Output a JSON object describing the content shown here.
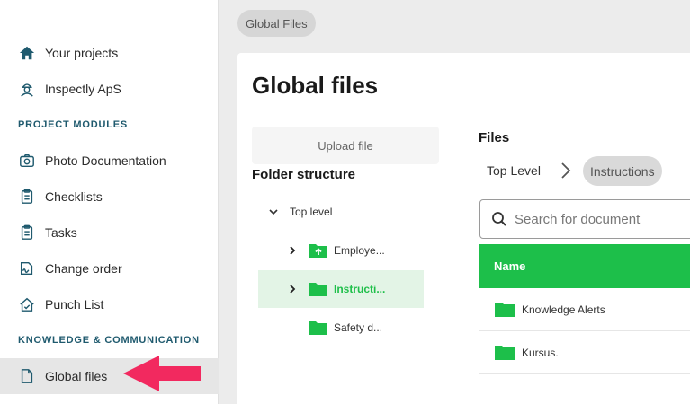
{
  "sidebar": {
    "items": [
      {
        "label": "Your projects",
        "icon": "home-icon"
      },
      {
        "label": "Inspectly ApS",
        "icon": "worker-icon"
      }
    ],
    "sections": [
      {
        "label": "PROJECT MODULES",
        "items": [
          {
            "label": "Photo Documentation",
            "icon": "camera-icon"
          },
          {
            "label": "Checklists",
            "icon": "clipboard-icon"
          },
          {
            "label": "Tasks",
            "icon": "clipboard-icon"
          },
          {
            "label": "Change order",
            "icon": "signature-icon"
          },
          {
            "label": "Punch List",
            "icon": "house-check-icon"
          }
        ]
      },
      {
        "label": "KNOWLEDGE & COMMUNICATION",
        "items": [
          {
            "label": "Global files",
            "icon": "file-icon",
            "active": true
          }
        ]
      }
    ]
  },
  "breadcrumb": {
    "label": "Global Files"
  },
  "page": {
    "title": "Global files"
  },
  "folders": {
    "upload_label": "Upload file",
    "heading": "Folder structure",
    "tree": [
      {
        "label": "Top level",
        "expanded": true
      },
      {
        "label": "Employe...",
        "icon": "folder-upload-icon"
      },
      {
        "label": "Instructi...",
        "selected": true
      },
      {
        "label": "Safety d..."
      }
    ]
  },
  "files": {
    "heading": "Files",
    "breadcrumb": {
      "top": "Top Level",
      "current": "Instructions"
    },
    "search_placeholder": "Search for document",
    "column_name": "Name",
    "rows": [
      "Knowledge Alerts",
      "Kursus."
    ]
  },
  "colors": {
    "accent": "#1dbf4a",
    "section_label": "#1f5a6e",
    "arrow": "#f2295f"
  }
}
